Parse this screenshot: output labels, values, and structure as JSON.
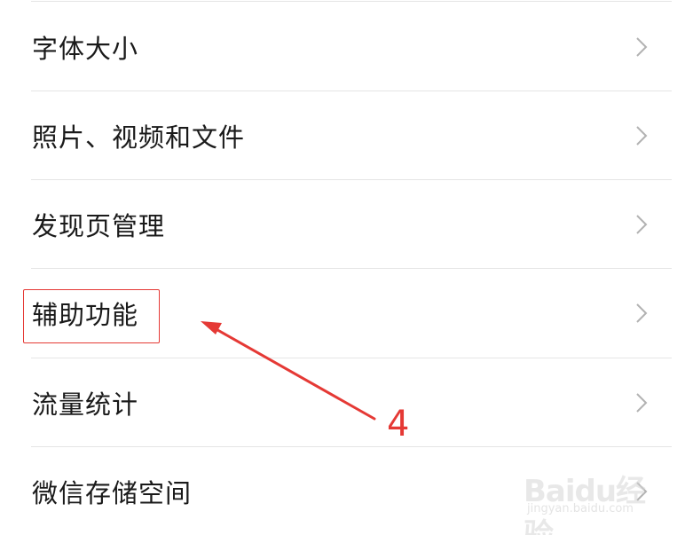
{
  "settings": {
    "items": [
      {
        "label": "字体大小"
      },
      {
        "label": "照片、视频和文件"
      },
      {
        "label": "发现页管理"
      },
      {
        "label": "辅助功能"
      },
      {
        "label": "流量统计"
      },
      {
        "label": "微信存储空间"
      }
    ]
  },
  "annotation": {
    "step_number": "4",
    "color": "#e53935"
  },
  "watermark": {
    "logo": "Baidu经验",
    "url": "jingyan.baidu.com"
  }
}
